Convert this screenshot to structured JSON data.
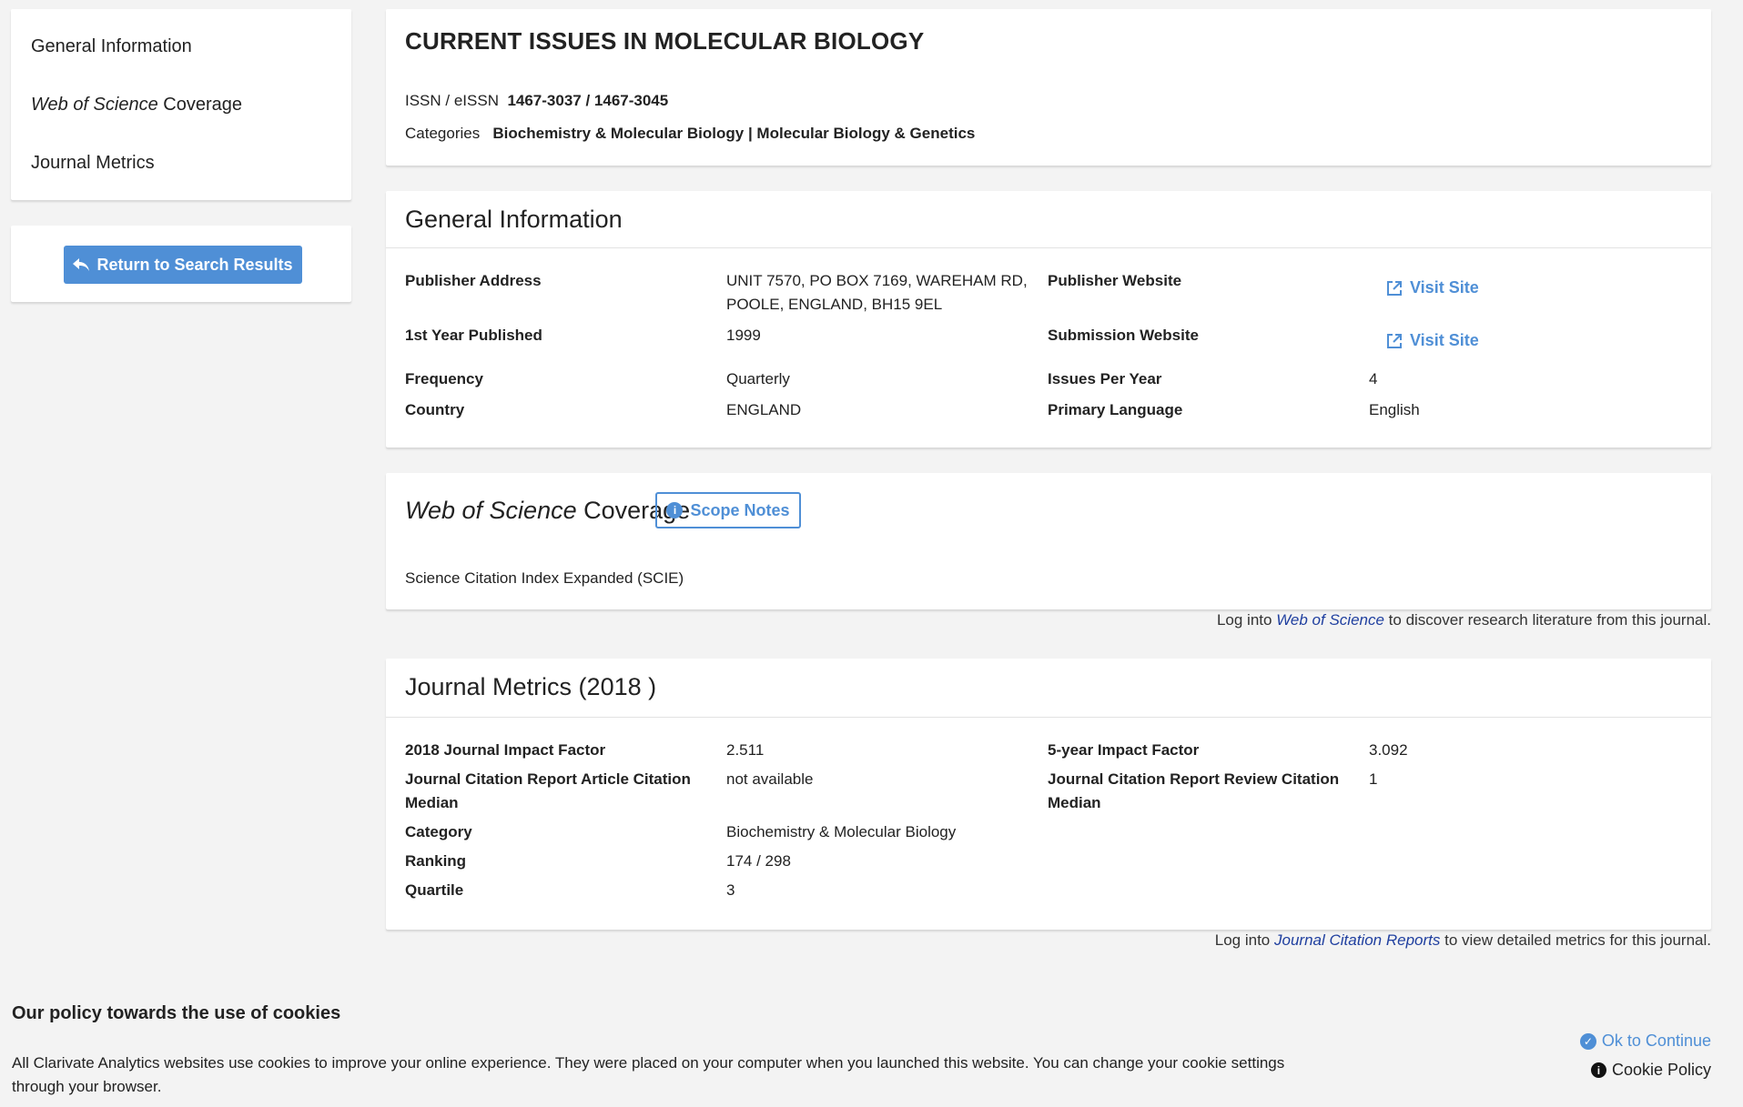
{
  "sidebar": {
    "items": [
      {
        "label_pre": "",
        "label_em": "",
        "label_post": "General Information"
      },
      {
        "label_pre": "",
        "label_em": "Web of Science",
        "label_post": " Coverage"
      },
      {
        "label_pre": "",
        "label_em": "",
        "label_post": "Journal Metrics"
      }
    ],
    "return_label": "Return to Search Results"
  },
  "header": {
    "title": "CURRENT ISSUES IN MOLECULAR BIOLOGY",
    "issn_label": "ISSN / eISSN",
    "issn_value": "1467-3037 / 1467-3045",
    "categories_label": "Categories",
    "categories_value": "Biochemistry & Molecular Biology | Molecular Biology & Genetics"
  },
  "general": {
    "title": "General Information",
    "publisher_address_label": "Publisher Address",
    "publisher_address_line1": "UNIT 7570, PO BOX 7169, WAREHAM RD,",
    "publisher_address_line2": "POOLE, ENGLAND, BH15 9EL",
    "publisher_website_label": "Publisher Website",
    "first_year_label": "1st Year Published",
    "first_year_value": "1999",
    "submission_website_label": "Submission Website",
    "visit_site_label": "Visit Site",
    "frequency_label": "Frequency",
    "frequency_value": "Quarterly",
    "issues_per_year_label": "Issues Per Year",
    "issues_per_year_value": "4",
    "country_label": "Country",
    "country_value": "ENGLAND",
    "primary_language_label": "Primary Language",
    "primary_language_value": "English"
  },
  "coverage": {
    "title_em": "Web of Science",
    "title_post": " Coverage",
    "scope_notes_label": "Scope Notes",
    "index_value": "Science Citation Index Expanded (SCIE)",
    "login_pre": "Log into ",
    "login_link": "Web of Science",
    "login_post": " to discover research literature from this journal."
  },
  "metrics": {
    "title": "Journal Metrics (2018 )",
    "jif_label": "2018 Journal Impact Factor",
    "jif_value": "2.511",
    "five_year_label": "5-year Impact Factor",
    "five_year_value": "3.092",
    "article_median_label_1": "Journal Citation Report Article Citation",
    "article_median_label_2": "Median",
    "article_median_value": "not available",
    "review_median_label_1": "Journal Citation Report Review Citation",
    "review_median_label_2": "Median",
    "review_median_value": "1",
    "category_label": "Category",
    "category_value": "Biochemistry & Molecular Biology",
    "ranking_label": "Ranking",
    "ranking_value": "174 / 298",
    "quartile_label": "Quartile",
    "quartile_value": "3",
    "login_pre": "Log into ",
    "login_link": "Journal Citation Reports",
    "login_post": " to view detailed metrics for this journal."
  },
  "cookie": {
    "title": "Our policy towards the use of cookies",
    "text": "All Clarivate Analytics websites use cookies to improve your online experience. They were placed on your computer when you launched this website. You can change your cookie settings through your browser.",
    "ok_label": "Ok to Continue",
    "policy_label": "Cookie Policy"
  },
  "colors": {
    "accent": "#4f8fd6",
    "link": "#1f3f9f",
    "background": "#f3f3f3"
  }
}
